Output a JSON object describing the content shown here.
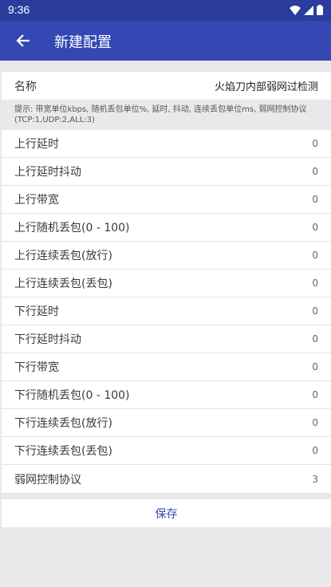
{
  "status_bar": {
    "time": "9:36"
  },
  "app_bar": {
    "title": "新建配置"
  },
  "name_field": {
    "label": "名称",
    "value": "火焰刀内部弱网过检测"
  },
  "hint": "提示: 带宽单位kbps, 随机丢包单位%, 延时, 抖动, 连续丢包单位ms, 弱网控制协议(TCP:1,UDP:2,ALL:3)",
  "rows": [
    {
      "label": "上行延时",
      "value": "0"
    },
    {
      "label": "上行延时抖动",
      "value": "0"
    },
    {
      "label": "上行带宽",
      "value": "0"
    },
    {
      "label": "上行随机丢包(0 - 100)",
      "value": "0"
    },
    {
      "label": "上行连续丢包(放行)",
      "value": "0"
    },
    {
      "label": "上行连续丢包(丢包)",
      "value": "0"
    },
    {
      "label": "下行延时",
      "value": "0"
    },
    {
      "label": "下行延时抖动",
      "value": "0"
    },
    {
      "label": "下行带宽",
      "value": "0"
    },
    {
      "label": "下行随机丢包(0 - 100)",
      "value": "0"
    },
    {
      "label": "下行连续丢包(放行)",
      "value": "0"
    },
    {
      "label": "下行连续丢包(丢包)",
      "value": "0"
    },
    {
      "label": "弱网控制协议",
      "value": "3"
    }
  ],
  "save_label": "保存",
  "colors": {
    "primary": "#3447b2",
    "status_bar": "#2a3d9c",
    "background": "#e9e9ec"
  }
}
